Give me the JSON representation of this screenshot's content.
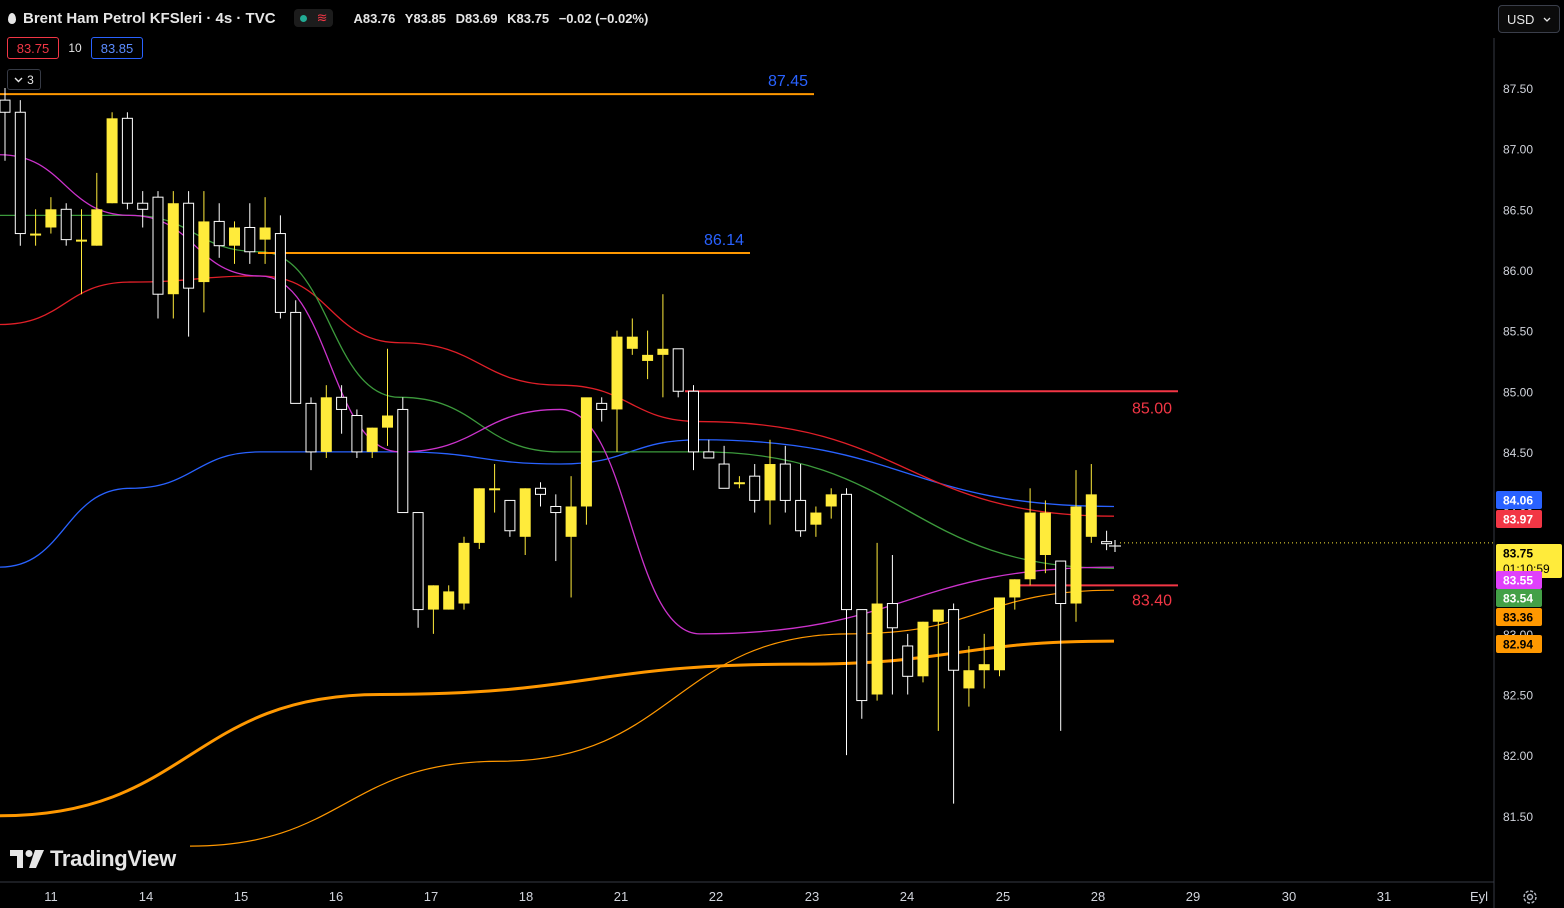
{
  "header": {
    "title": "Brent Ham Petrol KFSleri · 4s · TVC",
    "ohlc": {
      "open": "A83.76",
      "high": "Y83.85",
      "low": "D83.69",
      "close": "K83.75",
      "change": "−0.02 (−0.02%)"
    }
  },
  "trade": {
    "sell": "83.75",
    "spread": "10",
    "buy": "83.85"
  },
  "indicator_count": "3",
  "currency": "USD",
  "watermark": "TradingView",
  "colors": {
    "background": "#000000",
    "candle_up": "#ffeb3b",
    "candle_down": "#ffffff",
    "ma_blue": "#2962ff",
    "ma_red": "#e01f28",
    "ma_green": "#3c9a3c",
    "ma_magenta": "#cc33cc",
    "ma_orange": "#ff9800",
    "level_orange": "#ff9800",
    "level_red": "#f23645",
    "label_blue": "#2962ff",
    "label_red": "#f23645"
  },
  "chart_data": {
    "type": "candlestick",
    "y_axis": {
      "range": [
        81.2,
        87.85
      ],
      "ticks": [
        "87.50",
        "87.00",
        "86.50",
        "86.00",
        "85.50",
        "85.00",
        "84.50",
        "84.00",
        "83.50",
        "83.00",
        "82.50",
        "82.00",
        "81.50"
      ]
    },
    "x_axis": {
      "ticks": [
        "11",
        "14",
        "15",
        "16",
        "17",
        "18",
        "21",
        "22",
        "23",
        "24",
        "25",
        "28",
        "29",
        "30",
        "31",
        "Eyl"
      ]
    },
    "candles": [
      {
        "o": 87.4,
        "h": 87.5,
        "l": 86.9,
        "c": 87.3
      },
      {
        "o": 87.3,
        "h": 87.4,
        "l": 86.2,
        "c": 86.3
      },
      {
        "o": 86.3,
        "h": 86.5,
        "l": 86.2,
        "c": 86.3
      },
      {
        "o": 86.35,
        "h": 86.6,
        "l": 86.3,
        "c": 86.5
      },
      {
        "o": 86.5,
        "h": 86.55,
        "l": 86.2,
        "c": 86.25
      },
      {
        "o": 86.25,
        "h": 86.5,
        "l": 85.8,
        "c": 86.25
      },
      {
        "o": 86.2,
        "h": 86.8,
        "l": 86.2,
        "c": 86.5
      },
      {
        "o": 86.55,
        "h": 87.3,
        "l": 86.55,
        "c": 87.25
      },
      {
        "o": 87.25,
        "h": 87.3,
        "l": 86.5,
        "c": 86.55
      },
      {
        "o": 86.55,
        "h": 86.65,
        "l": 86.35,
        "c": 86.5
      },
      {
        "o": 86.6,
        "h": 86.65,
        "l": 85.6,
        "c": 85.8
      },
      {
        "o": 85.8,
        "h": 86.65,
        "l": 85.6,
        "c": 86.55
      },
      {
        "o": 86.55,
        "h": 86.65,
        "l": 85.45,
        "c": 85.85
      },
      {
        "o": 85.9,
        "h": 86.65,
        "l": 85.65,
        "c": 86.4
      },
      {
        "o": 86.4,
        "h": 86.55,
        "l": 86.1,
        "c": 86.2
      },
      {
        "o": 86.2,
        "h": 86.4,
        "l": 86.05,
        "c": 86.35
      },
      {
        "o": 86.35,
        "h": 86.55,
        "l": 86.05,
        "c": 86.15
      },
      {
        "o": 86.25,
        "h": 86.6,
        "l": 86.05,
        "c": 86.35
      },
      {
        "o": 86.3,
        "h": 86.45,
        "l": 85.6,
        "c": 85.65
      },
      {
        "o": 85.65,
        "h": 85.75,
        "l": 84.9,
        "c": 84.9
      },
      {
        "o": 84.9,
        "h": 84.95,
        "l": 84.35,
        "c": 84.5
      },
      {
        "o": 84.5,
        "h": 85.05,
        "l": 84.45,
        "c": 84.95
      },
      {
        "o": 84.95,
        "h": 85.05,
        "l": 84.65,
        "c": 84.85
      },
      {
        "o": 84.8,
        "h": 84.85,
        "l": 84.45,
        "c": 84.5
      },
      {
        "o": 84.5,
        "h": 84.7,
        "l": 84.45,
        "c": 84.7
      },
      {
        "o": 84.7,
        "h": 85.35,
        "l": 84.55,
        "c": 84.8
      },
      {
        "o": 84.85,
        "h": 84.95,
        "l": 84.0,
        "c": 84.0
      },
      {
        "o": 84.0,
        "h": 84.0,
        "l": 83.05,
        "c": 83.2
      },
      {
        "o": 83.2,
        "h": 83.4,
        "l": 83.0,
        "c": 83.4
      },
      {
        "o": 83.2,
        "h": 83.4,
        "l": 83.2,
        "c": 83.35
      },
      {
        "o": 83.25,
        "h": 83.8,
        "l": 83.2,
        "c": 83.75
      },
      {
        "o": 83.75,
        "h": 84.2,
        "l": 83.7,
        "c": 84.2
      },
      {
        "o": 84.2,
        "h": 84.4,
        "l": 84.0,
        "c": 84.2
      },
      {
        "o": 84.1,
        "h": 84.1,
        "l": 83.8,
        "c": 83.85
      },
      {
        "o": 83.8,
        "h": 84.2,
        "l": 83.65,
        "c": 84.2
      },
      {
        "o": 84.2,
        "h": 84.25,
        "l": 84.05,
        "c": 84.15
      },
      {
        "o": 84.05,
        "h": 84.15,
        "l": 83.6,
        "c": 84.0
      },
      {
        "o": 83.8,
        "h": 84.3,
        "l": 83.3,
        "c": 84.05
      },
      {
        "o": 84.05,
        "h": 84.75,
        "l": 83.9,
        "c": 84.95
      },
      {
        "o": 84.9,
        "h": 84.95,
        "l": 84.75,
        "c": 84.85
      },
      {
        "o": 84.85,
        "h": 85.5,
        "l": 84.5,
        "c": 85.45
      },
      {
        "o": 85.35,
        "h": 85.6,
        "l": 85.3,
        "c": 85.45
      },
      {
        "o": 85.25,
        "h": 85.5,
        "l": 85.1,
        "c": 85.3
      },
      {
        "o": 85.3,
        "h": 85.8,
        "l": 84.95,
        "c": 85.35
      },
      {
        "o": 85.35,
        "h": 85.35,
        "l": 84.95,
        "c": 85.0
      },
      {
        "o": 85.0,
        "h": 85.05,
        "l": 84.35,
        "c": 84.5
      },
      {
        "o": 84.5,
        "h": 84.6,
        "l": 84.45,
        "c": 84.45
      },
      {
        "o": 84.4,
        "h": 84.55,
        "l": 84.2,
        "c": 84.2
      },
      {
        "o": 84.25,
        "h": 84.3,
        "l": 84.2,
        "c": 84.25
      },
      {
        "o": 84.3,
        "h": 84.4,
        "l": 84.0,
        "c": 84.1
      },
      {
        "o": 84.1,
        "h": 84.6,
        "l": 83.9,
        "c": 84.4
      },
      {
        "o": 84.4,
        "h": 84.55,
        "l": 84.0,
        "c": 84.1
      },
      {
        "o": 84.1,
        "h": 84.4,
        "l": 83.8,
        "c": 83.85
      },
      {
        "o": 83.9,
        "h": 84.05,
        "l": 83.8,
        "c": 84.0
      },
      {
        "o": 84.05,
        "h": 84.2,
        "l": 83.95,
        "c": 84.15
      },
      {
        "o": 84.15,
        "h": 84.2,
        "l": 82.0,
        "c": 83.2
      },
      {
        "o": 83.2,
        "h": 83.2,
        "l": 82.3,
        "c": 82.45
      },
      {
        "o": 82.5,
        "h": 83.75,
        "l": 82.45,
        "c": 83.25
      },
      {
        "o": 83.25,
        "h": 83.65,
        "l": 82.5,
        "c": 83.05
      },
      {
        "o": 82.9,
        "h": 83.0,
        "l": 82.5,
        "c": 82.65
      },
      {
        "o": 82.65,
        "h": 83.1,
        "l": 82.6,
        "c": 83.1
      },
      {
        "o": 83.1,
        "h": 83.15,
        "l": 82.2,
        "c": 83.2
      },
      {
        "o": 83.2,
        "h": 83.25,
        "l": 81.6,
        "c": 82.7
      },
      {
        "o": 82.55,
        "h": 82.9,
        "l": 82.4,
        "c": 82.7
      },
      {
        "o": 82.7,
        "h": 83.0,
        "l": 82.55,
        "c": 82.75
      },
      {
        "o": 82.7,
        "h": 83.3,
        "l": 82.65,
        "c": 83.3
      },
      {
        "o": 83.3,
        "h": 83.45,
        "l": 83.2,
        "c": 83.45
      },
      {
        "o": 83.45,
        "h": 84.2,
        "l": 83.4,
        "c": 84.0
      },
      {
        "o": 83.65,
        "h": 84.1,
        "l": 83.5,
        "c": 84.0
      },
      {
        "o": 83.6,
        "h": 83.35,
        "l": 82.2,
        "c": 83.25
      },
      {
        "o": 83.25,
        "h": 84.35,
        "l": 83.1,
        "c": 84.05
      },
      {
        "o": 83.8,
        "h": 84.4,
        "l": 83.75,
        "c": 84.15
      },
      {
        "o": 83.76,
        "h": 83.85,
        "l": 83.69,
        "c": 83.75
      }
    ],
    "moving_averages": [
      {
        "color": "blue",
        "values": [
          83.55,
          84.2,
          84.5,
          84.5,
          84.4,
          84.6,
          84.05
        ]
      },
      {
        "color": "red",
        "values": [
          85.55,
          85.9,
          85.95,
          85.4,
          85.05,
          84.75,
          83.97
        ]
      },
      {
        "color": "green",
        "values": [
          86.45,
          86.45,
          86.15,
          84.95,
          84.5,
          84.5,
          83.54
        ]
      },
      {
        "color": "magenta",
        "values": [
          86.95,
          86.45,
          85.95,
          84.5,
          84.85,
          83.0,
          83.55
        ]
      },
      {
        "color": "orange_fast",
        "values": [
          81.25,
          81.95,
          83.0,
          83.36
        ]
      },
      {
        "color": "orange_slow",
        "values": [
          81.5,
          82.5,
          82.75,
          82.94
        ]
      }
    ],
    "levels": [
      {
        "value": "87.45",
        "color": "blue"
      },
      {
        "value": "86.14",
        "color": "blue"
      },
      {
        "value": "85.00",
        "color": "red"
      },
      {
        "value": "83.40",
        "color": "red"
      }
    ],
    "axis_badges": [
      {
        "value": "84.06",
        "color": "#2962ff",
        "text_color": "#ffffff"
      },
      {
        "value": "83.97",
        "color": "#f23645",
        "text_color": "#ffffff"
      },
      {
        "value": "83.75",
        "sub": "01:10:59",
        "color": "#ffeb3b",
        "text_color": "#000000"
      },
      {
        "value": "83.55",
        "color": "#e040fb",
        "text_color": "#ffffff"
      },
      {
        "value": "83.54",
        "color": "#43a047",
        "text_color": "#ffffff"
      },
      {
        "value": "83.36",
        "color": "#ff9800",
        "text_color": "#000000"
      },
      {
        "value": "82.94",
        "color": "#ff9800",
        "text_color": "#000000"
      }
    ]
  }
}
